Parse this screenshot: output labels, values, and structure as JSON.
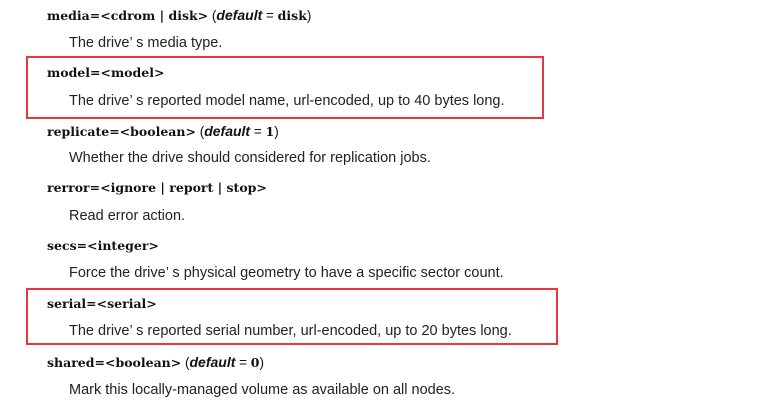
{
  "entries": [
    {
      "term": "media=<cdrom | disk>",
      "default_word": "default",
      "default_eq": " = ",
      "default_value": "disk",
      "paren_open": " (",
      "paren_close": ")",
      "description": "The drive’ s media type."
    },
    {
      "term": "model=<model>",
      "description": "The drive’ s reported model name, url-encoded, up to 40 bytes long."
    },
    {
      "term": "replicate=<boolean>",
      "default_word": "default",
      "default_eq": " = ",
      "default_value": "1",
      "paren_open": " (",
      "paren_close": ")",
      "description": "Whether the drive should considered for replication jobs."
    },
    {
      "term": "rerror=<ignore | report | stop>",
      "description": "Read error action."
    },
    {
      "term": "secs=<integer>",
      "description": "Force the drive’ s physical geometry to have a specific sector count."
    },
    {
      "term": "serial=<serial>",
      "description": "The drive’ s reported serial number, url-encoded, up to 20 bytes long."
    },
    {
      "term": "shared=<boolean>",
      "default_word": "default",
      "default_eq": " = ",
      "default_value": "0",
      "paren_open": " (",
      "paren_close": ")",
      "description": "Mark this locally-managed volume as available on all nodes."
    }
  ],
  "colors": {
    "highlight_border": "#e8383d",
    "text": "#222222"
  }
}
